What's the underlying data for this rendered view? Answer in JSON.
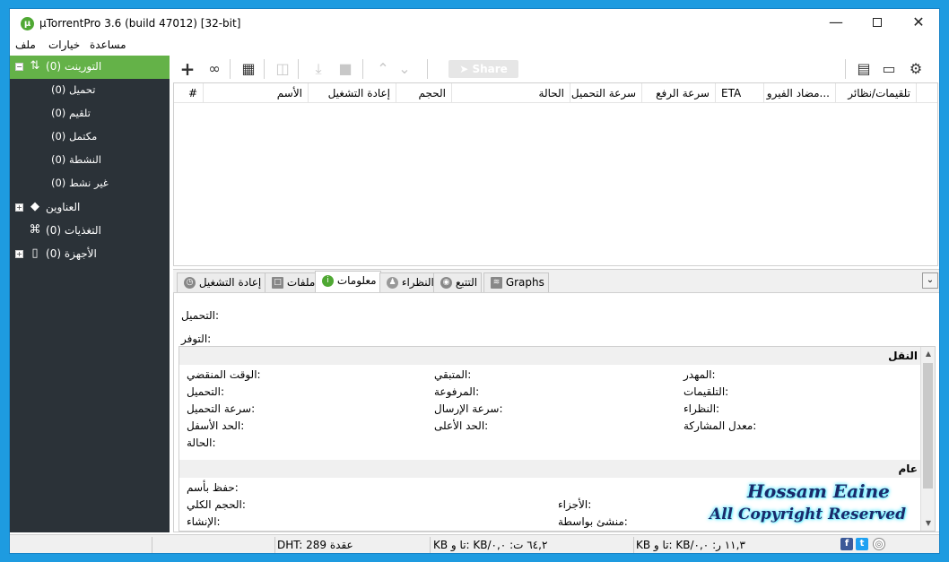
{
  "window": {
    "title": "µTorrentPro 3.6  (build 47012) [32-bit]"
  },
  "menu": [
    "ملف",
    "خيارات",
    "مساعدة"
  ],
  "sidebar": {
    "torrents": "التورينت (0)",
    "items": [
      "(0) تحميل",
      "(0) تلقيم",
      "(0) مكتمل",
      "(0) النشطة",
      "(0) غير نشط"
    ],
    "labels": "العناوين",
    "feeds": "التغذيات (0)",
    "devices": "الأجهزة (0)"
  },
  "toolbar": {
    "share_label": "Share"
  },
  "list": {
    "columns": [
      "#",
      "الأسم",
      "إعادة التشغيل",
      "الحجم",
      "الحالة",
      "سرعة التحميل",
      "سرعة الرفع",
      "ETA",
      "مضاد الفيرو...",
      "تلقيمات/نظائر"
    ]
  },
  "tabs": [
    "إعادة التشغيل",
    "ملفات",
    "معلومات",
    "النظراء",
    "التتبع",
    "Graphs"
  ],
  "info": {
    "download": ":التحميل",
    "availability": ":التوفر",
    "transfer_title": "النقل",
    "transfer_fields": {
      "time_elapsed": ":الوقت المنقضي",
      "remaining": ":المتبقي",
      "wasted": ":المهدر",
      "downloaded": ":التحميل",
      "uploaded": ":المرفوعة",
      "seeds": ":التلقيمات",
      "download_speed": ":سرعة التحميل",
      "upload_speed": ":سرعة الإرسال",
      "peers": ":النظراء",
      "down_limit": ":الحد الأسفل",
      "up_limit": ":الحد الأعلى",
      "share_ratio": ":معدل المشاركة",
      "status": ":الحالة"
    },
    "general_title": "عام",
    "general_fields": {
      "save_as": ":حفظ بأسم",
      "total_size": ":الحجم الكلي",
      "pieces": ":الأجزاء",
      "created_on": ":الإنشاء",
      "created_by": ":منشئ بواسطة"
    }
  },
  "status": {
    "dht": "DHT: 289 عقدة",
    "download": "KB تا و: KB/٦٤,٢ ت: ٠,٠",
    "upload": "KB تا و: KB/١١,٣ ر: ٠,٠"
  },
  "watermark": {
    "line1": "Hossam Eaine",
    "line2": "All Copyright Reserved"
  }
}
